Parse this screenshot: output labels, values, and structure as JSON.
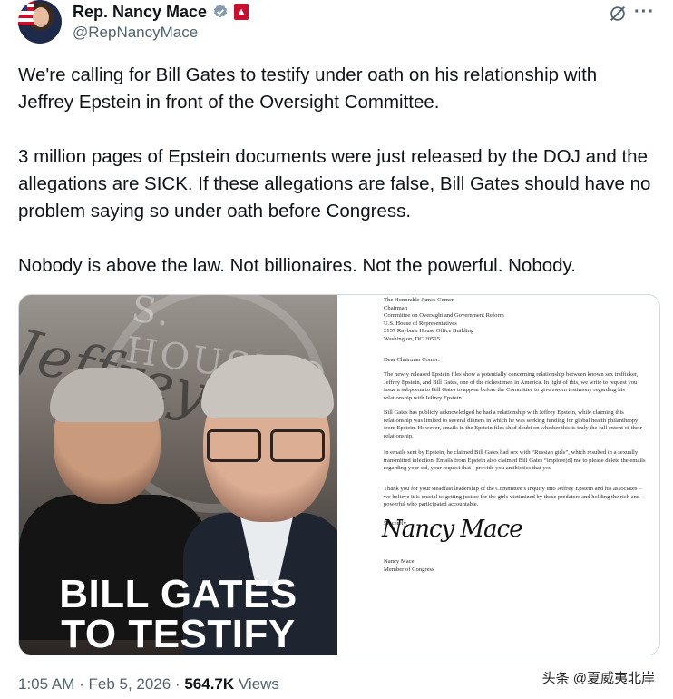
{
  "author": {
    "display_name": "Rep. Nancy Mace",
    "handle": "@RepNancyMace"
  },
  "header_icons": {
    "verified": "verified-badge-icon",
    "affiliation": "government-affiliation-icon",
    "grok": "grok-icon",
    "more": "···"
  },
  "tweet": {
    "paragraphs": [
      "We're calling for Bill Gates to testify under oath on his relationship with Jeffrey Epstein in front of the Oversight Committee.",
      "3 million pages of Epstein documents were just released by the DOJ and the allegations are SICK. If these allegations are false, Bill Gates should have no problem saying so under oath before Congress.",
      "Nobody is above the law. Not billionaires. Not the powerful. Nobody."
    ]
  },
  "media": {
    "background_word": "Jeffrey",
    "seal_text": "S. HOUSE O",
    "headline_line1": "BILL GATES",
    "headline_line2": "TO TESTIFY",
    "letter": {
      "address": [
        "The Honorable James Comer",
        "Chairman",
        "Committee on Oversight and Government Reform",
        "U.S. House of Representatives",
        "2157 Rayburn House Office Building",
        "Washington, DC 20515"
      ],
      "greeting": "Dear Chairman Comer:",
      "p1": "The newly released Epstein files show a potentially concerning relationship between known sex trafficker, Jeffrey Epstein, and Bill Gates, one of the richest men in America. In light of this, we write to request you issue a subpoena to Bill Gates to appear before the Committee to give sworn testimony regarding his relationship with Jeffrey Epstein.",
      "p2": "Bill Gates has publicly acknowledged he had a relationship with Jeffrey Epstein, while claiming this relationship was limited to several dinners in which he was seeking funding for global health philanthropy from Epstein. However, emails in the Epstein files shed doubt on whether this is truly the full extent of their relationship.",
      "p3": "In emails sent by Epstein, he claimed Bill Gates had sex with “Russian girls”, which resulted in a sexually transmitted infection. Emails from Epstein also claimed Bill Gates “implore[d] me to please delete the emails regarding your std, your request that I provide you antibiotics that you",
      "p4": "Thank you for your steadfast leadership of the Committee’s inquiry into Jeffrey Epstein and his associates – we believe it is crucial to getting justice for the girls victimized by these predators and holding the rich and powerful who participated accountable.",
      "sign_off": "Sincerely,",
      "signature": "Nancy Mace",
      "signer_name": "Nancy Mace",
      "signer_title": "Member of Congress"
    }
  },
  "meta": {
    "time": "1:05 AM",
    "sep1": " · ",
    "date": "Feb 5, 2026",
    "sep2": " · ",
    "views_count": "564.7K",
    "views_label": " Views"
  },
  "watermark": "头条 @夏威夷北岸"
}
